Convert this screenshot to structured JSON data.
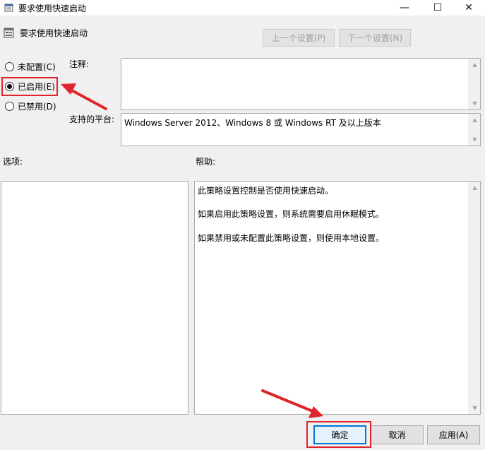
{
  "window": {
    "title": "要求使用快速启动",
    "minimize_glyph": "—",
    "maximize_glyph": "☐",
    "close_glyph": "✕",
    "icon": "policy-window-icon"
  },
  "header": {
    "policy_name": "要求使用快速启动",
    "icon": "policy-setting-icon",
    "prev_setting_label": "上一个设置(P)",
    "next_setting_label": "下一个设置(N)"
  },
  "state_options": [
    {
      "label": "未配置(C)",
      "checked": false
    },
    {
      "label": "已启用(E)",
      "checked": true
    },
    {
      "label": "已禁用(D)",
      "checked": false
    }
  ],
  "comment": {
    "label": "注释:",
    "value": ""
  },
  "supported_platforms": {
    "label": "支持的平台:",
    "value": "Windows Server 2012、Windows 8 或 Windows RT 及以上版本"
  },
  "options_section": {
    "label": "选项:"
  },
  "help_section": {
    "label": "帮助:",
    "lines": [
      "此策略设置控制是否使用快速启动。",
      "如果启用此策略设置，则系统需要启用休眠模式。",
      "如果禁用或未配置此策略设置，则使用本地设置。"
    ]
  },
  "footer": {
    "ok_label": "确定",
    "cancel_label": "取消",
    "apply_label": "应用(A)"
  },
  "annotation_color": "#e0242b",
  "accent_color": "#0078d7"
}
